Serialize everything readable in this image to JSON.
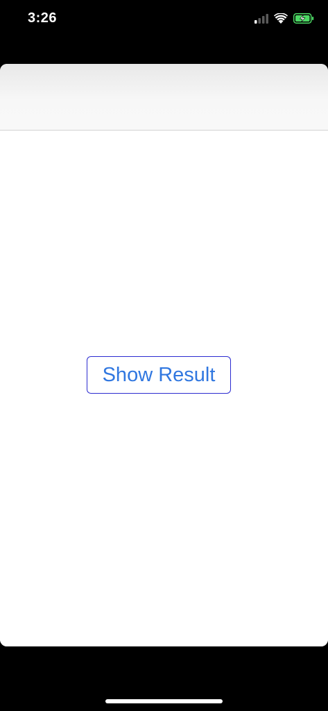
{
  "status_bar": {
    "time": "3:26",
    "signal_icon": "cellular-signal-icon",
    "wifi_icon": "wifi-icon",
    "battery_icon": "battery-charging-icon",
    "battery_color": "#4cd964"
  },
  "nav_bar": {
    "title": ""
  },
  "main": {
    "show_result_label": "Show Result",
    "button_text_color": "#3077e0",
    "button_border_color": "#2a2ad0"
  }
}
